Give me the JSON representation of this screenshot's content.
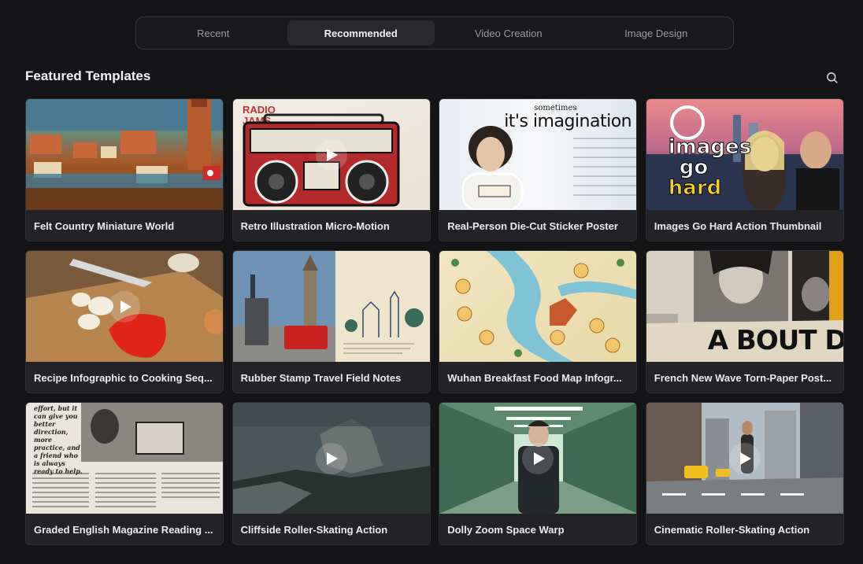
{
  "tabs": [
    {
      "label": "Recent",
      "active": false
    },
    {
      "label": "Recommended",
      "active": true
    },
    {
      "label": "Video Creation",
      "active": false
    },
    {
      "label": "Image Design",
      "active": false
    }
  ],
  "section": {
    "title": "Featured Templates",
    "search_icon": "search-icon"
  },
  "templates": [
    {
      "title": "Felt Country Miniature World",
      "has_play": false
    },
    {
      "title": "Retro Illustration Micro-Motion",
      "has_play": true
    },
    {
      "title": "Real-Person Die-Cut Sticker Poster",
      "has_play": false,
      "thumb_text": "sometimes it's imagination"
    },
    {
      "title": "Images Go Hard Action Thumbnail",
      "has_play": false,
      "thumb_text": "images go hard"
    },
    {
      "title": "Recipe Infographic to Cooking Seq...",
      "has_play": true
    },
    {
      "title": "Rubber Stamp Travel Field Notes",
      "has_play": false
    },
    {
      "title": "Wuhan Breakfast Food Map Infogr...",
      "has_play": false
    },
    {
      "title": "French New Wave Torn-Paper Post...",
      "has_play": false,
      "thumb_text": "A BOUT DE"
    },
    {
      "title": "Graded English Magazine Reading ...",
      "has_play": false,
      "thumb_text": "effort, but it can give you better direction, more practice, and a friend who is always ready to help."
    },
    {
      "title": "Cliffside Roller-Skating Action",
      "has_play": true
    },
    {
      "title": "Dolly Zoom Space Warp",
      "has_play": true
    },
    {
      "title": "Cinematic Roller-Skating Action",
      "has_play": true
    }
  ]
}
